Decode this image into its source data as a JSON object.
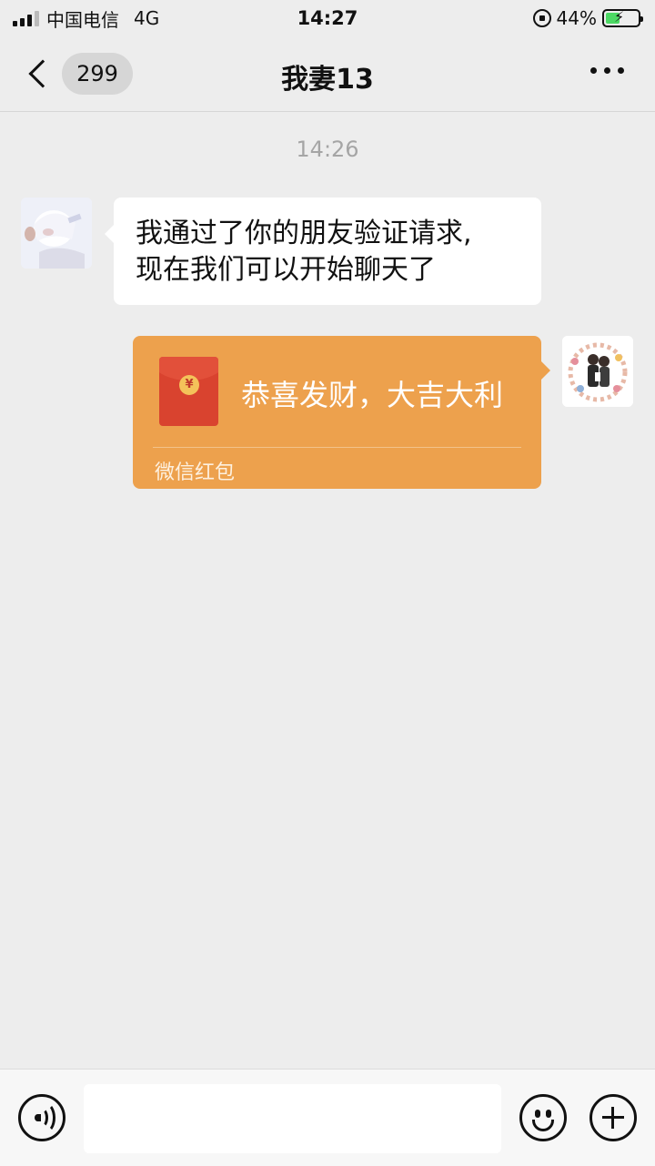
{
  "status_bar": {
    "carrier": "中国电信",
    "network": "4G",
    "time": "14:27",
    "battery_percent": "44%",
    "battery_level": 0.44,
    "charging": true
  },
  "nav": {
    "unread_count": "299",
    "title": "我妻13",
    "back_icon": "chevron-left-icon",
    "more_icon": "ellipsis-icon"
  },
  "chat": {
    "timestamp": "14:26",
    "messages": [
      {
        "side": "left",
        "type": "text",
        "lines": [
          "我通过了你的朋友验证请求,",
          "现在我们可以开始聊天了"
        ]
      },
      {
        "side": "right",
        "type": "red_packet",
        "greeting": "恭喜发财，大吉大利",
        "label": "微信红包",
        "coin_symbol": "¥"
      }
    ]
  },
  "toolbar": {
    "voice_icon": "voice-icon",
    "emoji_icon": "emoji-icon",
    "plus_icon": "plus-icon",
    "input_value": ""
  },
  "colors": {
    "background": "#ededed",
    "bubble_in": "#ffffff",
    "red_packet": "#eda14d",
    "red_envelope": "#d9432f",
    "battery_fill": "#4cd964"
  }
}
